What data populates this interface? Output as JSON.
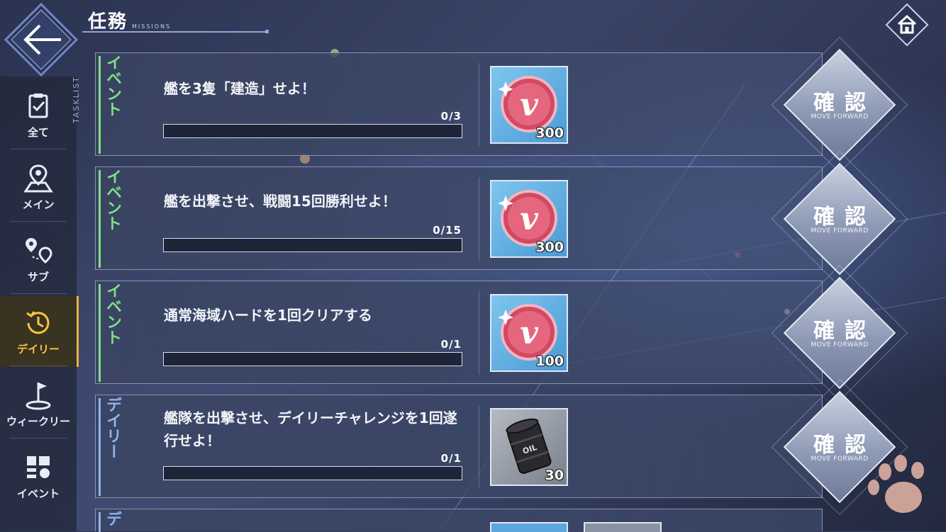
{
  "header": {
    "title": "任務",
    "subtitle": "MISSIONS"
  },
  "sidebar": {
    "tasklist_label": "TASKLIST",
    "items": [
      {
        "label": "全て",
        "icon": "clipboard-check-icon",
        "active": false
      },
      {
        "label": "メイン",
        "icon": "map-pin-icon",
        "active": false
      },
      {
        "label": "サブ",
        "icon": "route-pins-icon",
        "active": false
      },
      {
        "label": "デイリー",
        "icon": "clock-history-icon",
        "active": true
      },
      {
        "label": "ウィークリー",
        "icon": "flag-icon",
        "active": false
      },
      {
        "label": "イベント",
        "icon": "grid-list-icon",
        "active": false
      }
    ]
  },
  "missions": [
    {
      "category": "イベント",
      "category_color": "#7fe08a",
      "title": "艦を3隻「建造」せよ！",
      "progress": "0/3",
      "progress_fraction": 0,
      "reward": {
        "type": "v-coin-icon",
        "qty": "300"
      },
      "confirm": "確認",
      "confirm_sub": "MOVE FORWARD"
    },
    {
      "category": "イベント",
      "category_color": "#7fe08a",
      "title": "艦を出撃させ、戦闘15回勝利せよ！",
      "progress": "0/15",
      "progress_fraction": 0,
      "reward": {
        "type": "v-coin-icon",
        "qty": "300"
      },
      "confirm": "確認",
      "confirm_sub": "MOVE FORWARD"
    },
    {
      "category": "イベント",
      "category_color": "#7fe08a",
      "title": "通常海域ハードを1回クリアする",
      "progress": "0/1",
      "progress_fraction": 0,
      "reward": {
        "type": "v-coin-icon",
        "qty": "100"
      },
      "confirm": "確認",
      "confirm_sub": "MOVE FORWARD"
    },
    {
      "category": "デイリー",
      "category_color": "#8fb4f0",
      "title": "艦隊を出撃させ、デイリーチャレンジを1回遂行せよ！",
      "progress": "0/1",
      "progress_fraction": 0,
      "reward": {
        "type": "oil-barrel-icon",
        "qty": "30",
        "barrel_label": "OIL"
      },
      "confirm": "確認",
      "confirm_sub": "MOVE FORWARD"
    }
  ],
  "partial_card": {
    "category": "デ"
  },
  "colors": {
    "accent": "#ffc542",
    "event": "#7fe08a",
    "daily": "#8fb4f0"
  }
}
